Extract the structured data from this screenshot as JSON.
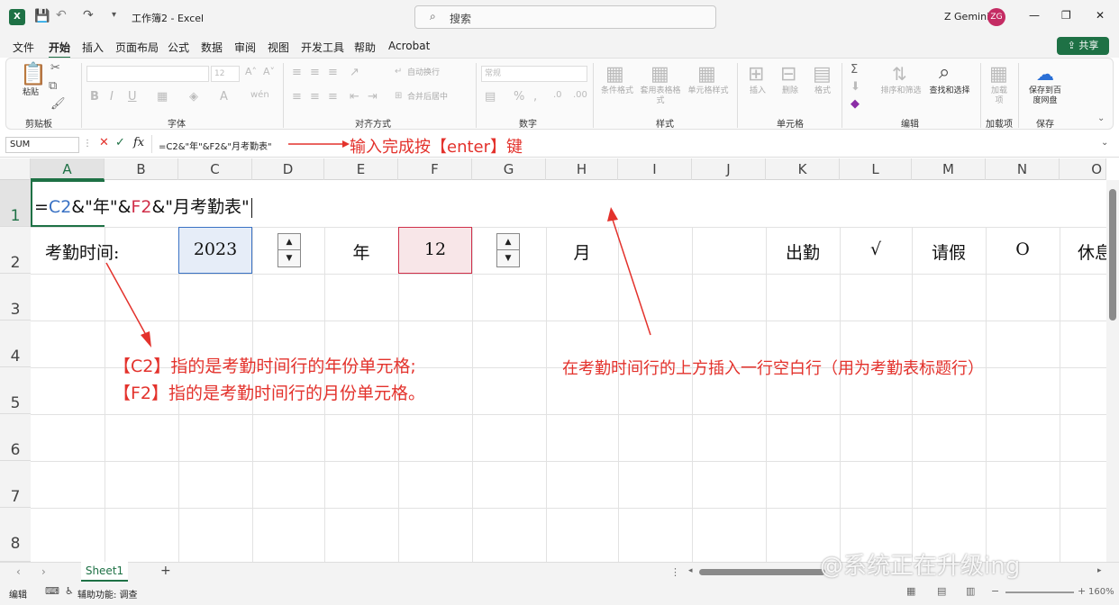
{
  "window": {
    "title": "工作簿2 - Excel",
    "search_placeholder": "搜索",
    "user": "Z Gemini",
    "user_initials": "ZG",
    "min": "—",
    "max": "❐",
    "close": "✕"
  },
  "menu": [
    "文件",
    "开始",
    "插入",
    "页面布局",
    "公式",
    "数据",
    "审阅",
    "视图",
    "开发工具",
    "帮助",
    "Acrobat"
  ],
  "share_label": "共享",
  "ribbon": {
    "groups": [
      "剪贴板",
      "字体",
      "对齐方式",
      "数字",
      "样式",
      "单元格",
      "编辑",
      "加载项",
      "保存"
    ],
    "paste": "粘贴",
    "font_size": "12",
    "wrap": "自动换行",
    "merge": "合并后居中",
    "number_format": "常规",
    "cond_format": "条件格式",
    "table_format": "套用表格格式",
    "cell_style": "单元格样式",
    "insert": "插入",
    "delete": "删除",
    "format": "格式",
    "sort_filter": "排序和筛选",
    "find_select": "查找和选择",
    "addins": "加载项",
    "save_baidu": "保存到百度网盘"
  },
  "formula_bar": {
    "name_box": "SUM",
    "fx": "fx",
    "formula": "=C2&\"年\"&F2&\"月考勤表\""
  },
  "annotations": {
    "formula_hint": "输入完成按【enter】键",
    "c2_note": "【C2】指的是考勤时间行的年份单元格;",
    "f2_note": "【F2】指的是考勤时间行的月份单元格。",
    "row_note": "在考勤时间行的上方插入一行空白行（用为考勤表标题行）"
  },
  "columns": [
    "A",
    "B",
    "C",
    "D",
    "E",
    "F",
    "G",
    "H",
    "I",
    "J",
    "K",
    "L",
    "M",
    "N",
    "O"
  ],
  "rows": [
    "1",
    "2",
    "3",
    "4",
    "5",
    "6",
    "7",
    "8"
  ],
  "cells": {
    "a1_parts": [
      "=",
      "C2",
      "&\"年\"&",
      "F2",
      "&\"月考勤表\""
    ],
    "a2": "考勤时间:",
    "c2": "2023",
    "e2": "年",
    "f2": "12",
    "h2": "月",
    "k2": "出勤",
    "l2": "√",
    "m2": "请假",
    "n2": "O",
    "o2": "休息"
  },
  "colors": {
    "excel_green": "#1e7145",
    "annot_red": "#e3322c",
    "c2_ref": "#3a72c4",
    "f2_ref": "#d0304a"
  },
  "sheet_tab": "Sheet1",
  "status": {
    "mode": "编辑",
    "accessibility": "辅助功能: 调查",
    "zoom": "160%"
  },
  "watermark": "@系统正在升级ing"
}
